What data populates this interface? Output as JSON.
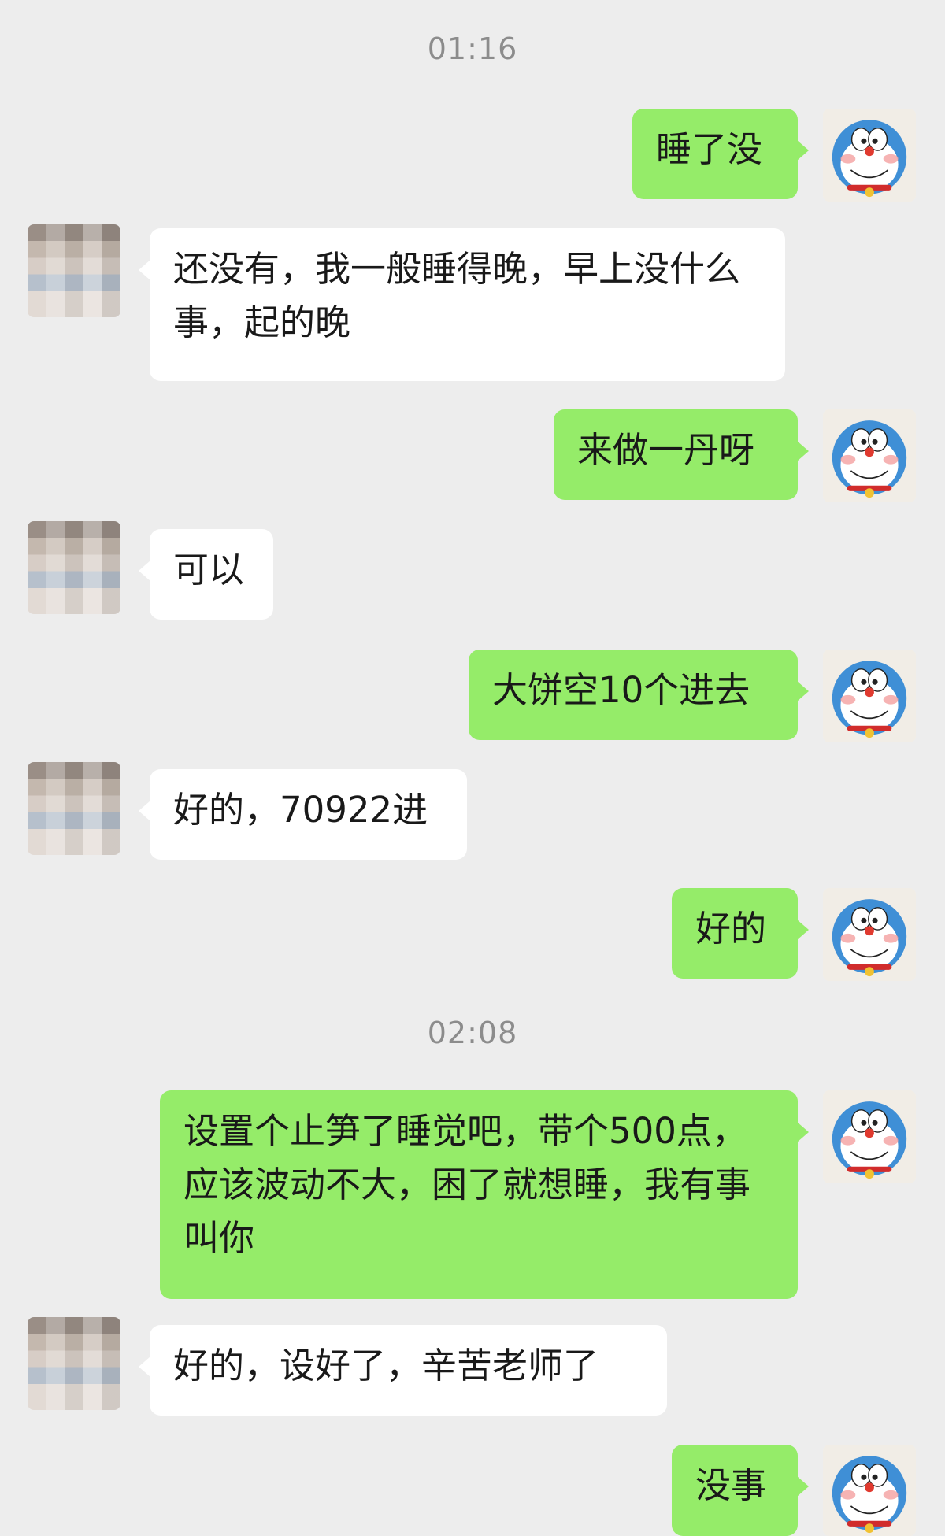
{
  "timestamps": [
    "01:16",
    "02:08"
  ],
  "messages": [
    {
      "from": "me",
      "text": "睡了没"
    },
    {
      "from": "them",
      "text": "还没有，我一般睡得晚，早上没什么事，起的晚"
    },
    {
      "from": "me",
      "text": "来做一丹呀"
    },
    {
      "from": "them",
      "text": "可以"
    },
    {
      "from": "me",
      "text": "大饼空10个进去"
    },
    {
      "from": "them",
      "text": "好的，70922进"
    },
    {
      "from": "me",
      "text": "好的"
    },
    {
      "from": "me",
      "text": "设置个止笋了睡觉吧，带个500点，应该波动不大，困了就想睡，我有事叫你"
    },
    {
      "from": "them",
      "text": "好的，设好了，辛苦老师了"
    },
    {
      "from": "me",
      "text": "没事"
    }
  ],
  "avatars": {
    "mine": "doraemon-avatar",
    "theirs": "blurred-contact-avatar"
  },
  "colors": {
    "background": "#ededed",
    "my_bubble": "#95ec69",
    "their_bubble": "#ffffff",
    "text": "#191919",
    "timestamp": "#8c8c8c"
  }
}
